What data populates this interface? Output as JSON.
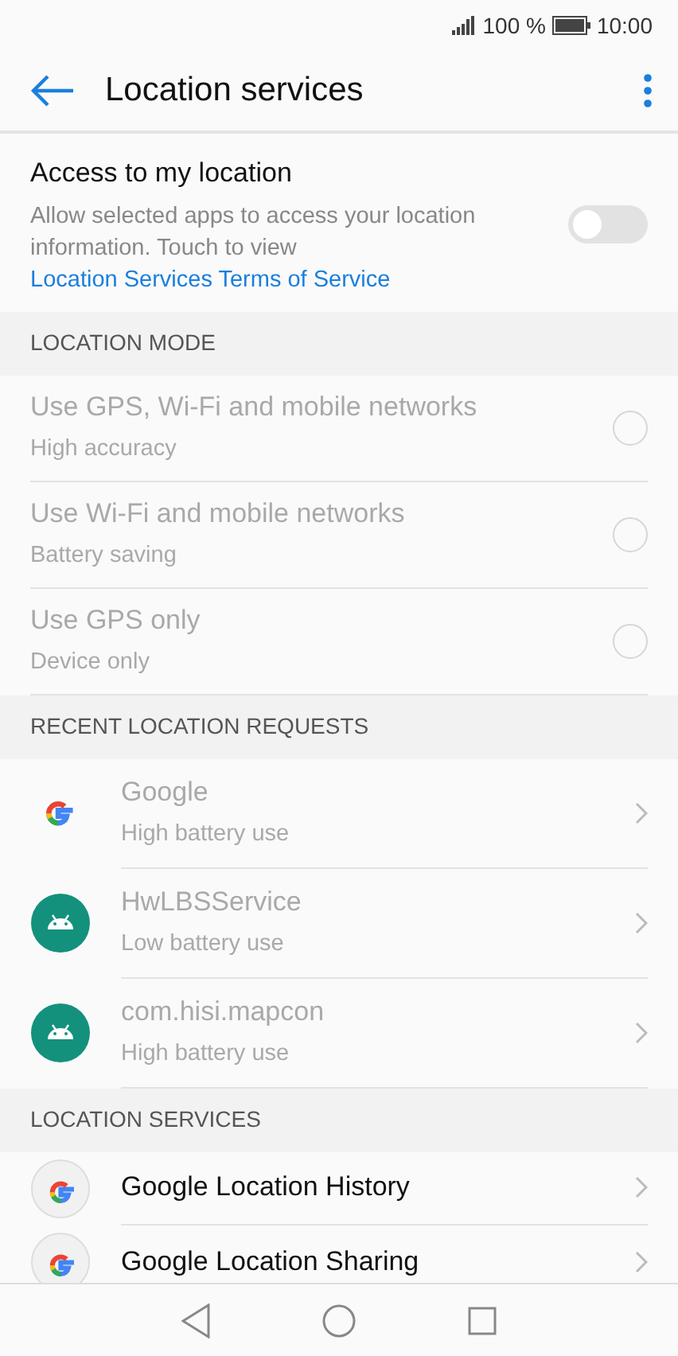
{
  "status_bar": {
    "battery": "100 %",
    "time": "10:00"
  },
  "app_bar": {
    "title": "Location services"
  },
  "access": {
    "title": "Access to my location",
    "description": "Allow selected apps to access your location information. Touch to view ",
    "link": "Location Services Terms of Service",
    "on": false
  },
  "sections": [
    {
      "header": "LOCATION MODE",
      "kind": "radio",
      "items": [
        {
          "title": "Use GPS, Wi-Fi and mobile networks",
          "subtitle": "High accuracy",
          "selected": false,
          "disabled": true
        },
        {
          "title": "Use Wi-Fi and mobile networks",
          "subtitle": "Battery saving",
          "selected": false,
          "disabled": true
        },
        {
          "title": "Use GPS only",
          "subtitle": "Device only",
          "selected": false,
          "disabled": true
        }
      ]
    },
    {
      "header": "RECENT LOCATION REQUESTS",
      "kind": "app",
      "items": [
        {
          "title": "Google",
          "subtitle": "High battery use",
          "kind": "google",
          "disabled": true
        },
        {
          "title": "HwLBSService",
          "subtitle": "Low battery use",
          "kind": "android",
          "disabled": true
        },
        {
          "title": "com.hisi.mapcon",
          "subtitle": "High battery use",
          "kind": "android",
          "disabled": true
        }
      ]
    },
    {
      "header": "LOCATION SERVICES",
      "kind": "app",
      "items": [
        {
          "title": "Google Location History",
          "kind": "service",
          "disabled": false
        },
        {
          "title": "Google Location Sharing",
          "kind": "service",
          "disabled": false
        }
      ]
    }
  ]
}
